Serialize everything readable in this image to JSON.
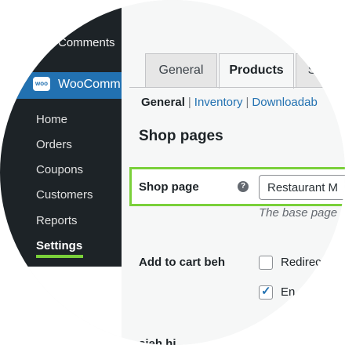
{
  "sidebar": {
    "comments_label": "Comments",
    "woo_badge": "woo",
    "woo_label": "WooComm",
    "items": [
      {
        "label": "Home"
      },
      {
        "label": "Orders"
      },
      {
        "label": "Coupons"
      },
      {
        "label": "Customers"
      },
      {
        "label": "Reports"
      },
      {
        "label": "Settings",
        "active": true
      }
    ]
  },
  "tabs": [
    {
      "label": "General"
    },
    {
      "label": "Products",
      "active": true
    },
    {
      "label": "S"
    }
  ],
  "subnav": {
    "current": "General",
    "links": [
      "Inventory",
      "Downloadab"
    ]
  },
  "section": {
    "title": "Shop pages"
  },
  "shop_page": {
    "label": "Shop page",
    "help_icon": "?",
    "select_value": "Restaurant M",
    "description": "The base page"
  },
  "add_to_cart": {
    "label": "Add to cart beh",
    "options": [
      {
        "label": "Redirec",
        "checked": false
      },
      {
        "label": "En",
        "checked": true
      }
    ]
  },
  "next_row_label": "sieh hi",
  "colors": {
    "sidebar_bg": "#1d2327",
    "woo_accent": "#2271b1",
    "highlight": "#7ad03a"
  }
}
